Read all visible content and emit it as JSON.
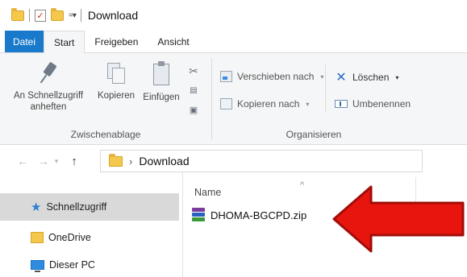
{
  "window": {
    "title": "Download"
  },
  "tabs": [
    {
      "label": "Datei"
    },
    {
      "label": "Start"
    },
    {
      "label": "Freigeben"
    },
    {
      "label": "Ansicht"
    }
  ],
  "ribbon": {
    "clipboard": {
      "group_label": "Zwischenablage",
      "pin_line1": "An Schnellzugriff",
      "pin_line2": "anheften",
      "copy_label": "Kopieren",
      "paste_label": "Einfügen"
    },
    "organize": {
      "group_label": "Organisieren",
      "move_label": "Verschieben nach",
      "copyto_label": "Kopieren nach",
      "delete_label": "Löschen",
      "rename_label": "Umbenennen"
    }
  },
  "address": {
    "path": "Download"
  },
  "nav_pane": {
    "items": [
      {
        "label": "Schnellzugriff",
        "icon": "star-icon"
      },
      {
        "label": "OneDrive",
        "icon": "onedrive-icon"
      },
      {
        "label": "Dieser PC",
        "icon": "pc-icon"
      }
    ]
  },
  "content": {
    "column_name": "Name",
    "files": [
      {
        "name": "DHOMA-BGCPD.zip",
        "icon": "winrar-archive-icon"
      }
    ]
  },
  "annotation": {
    "color": "#e8150f"
  }
}
